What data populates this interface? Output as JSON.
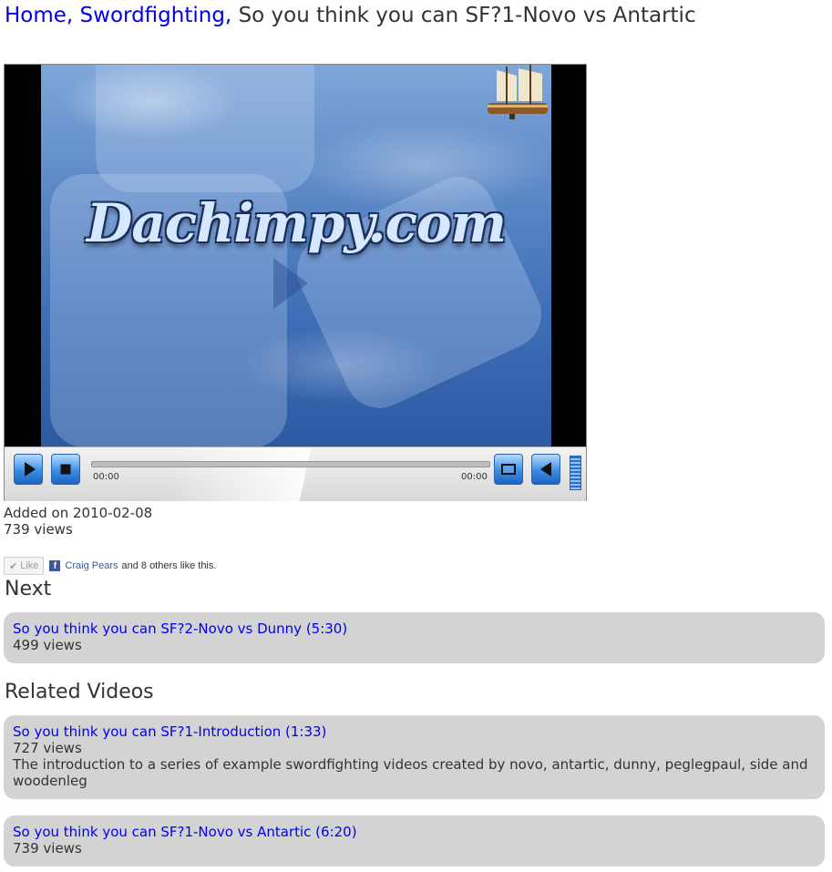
{
  "breadcrumb": {
    "home": "Home,",
    "category": "Swordfighting,",
    "current": "So you think you can SF?1-Novo vs Antartic"
  },
  "player": {
    "logo_text": "Dachimpy.com",
    "time_elapsed": "00:00",
    "time_total": "00:00"
  },
  "meta": {
    "added": "Added on 2010-02-08",
    "views": "739 views"
  },
  "facebook": {
    "like_label": "Like",
    "friend_name": "Craig Pears",
    "others_text": "and 8 others like this."
  },
  "next": {
    "heading": "Next",
    "items": [
      {
        "title": "So you think you can SF?2-Novo vs Dunny (5:30)",
        "views": "499 views"
      }
    ]
  },
  "related": {
    "heading": "Related Videos",
    "items": [
      {
        "title": "So you think you can SF?1-Introduction (1:33)",
        "views": "727 views",
        "description": "The introduction to a series of example swordfighting videos created by novo, antartic, dunny, peglegpaul, side and woodenleg"
      },
      {
        "title": "So you think you can SF?1-Novo vs Antartic (6:20)",
        "views": "739 views"
      }
    ]
  },
  "colors": {
    "link": "#0000ee",
    "card_bg": "#d3d3d3",
    "text": "#333333",
    "facebook": "#3b5998"
  },
  "icons": [
    "play-icon",
    "stop-icon",
    "fullscreen-icon",
    "volume-icon",
    "check-icon",
    "facebook-icon"
  ]
}
